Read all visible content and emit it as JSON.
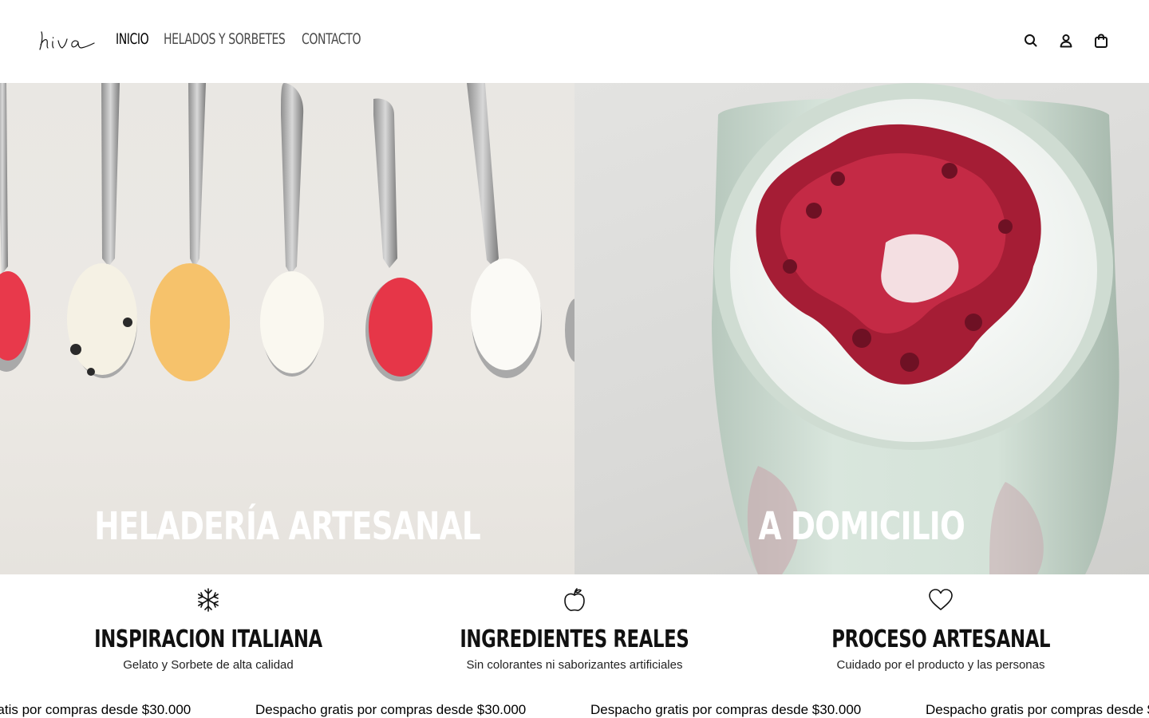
{
  "header": {
    "logo_text": "hiva",
    "nav": [
      {
        "label": "INICIO",
        "active": true
      },
      {
        "label": "HELADOS Y SORBETES",
        "active": false
      },
      {
        "label": "CONTACTO",
        "active": false
      }
    ],
    "icons": [
      "search-icon",
      "account-icon",
      "cart-icon"
    ]
  },
  "hero": {
    "left": {
      "title": "HELADERÍA ARTESANAL"
    },
    "right": {
      "title": "A DOMICILIO"
    }
  },
  "features": [
    {
      "icon": "snowflake-icon",
      "title": "INSPIRACION ITALIANA",
      "subtitle": "Gelato y Sorbete de alta calidad"
    },
    {
      "icon": "apple-icon",
      "title": "INGREDIENTES REALES",
      "subtitle": "Sin colorantes ni saborizantes artificiales"
    },
    {
      "icon": "heart-icon",
      "title": "PROCESO ARTESANAL",
      "subtitle": "Cuidado por el producto y las personas"
    }
  ],
  "announcement": {
    "text": "Despacho gratis por compras desde $30.000"
  }
}
